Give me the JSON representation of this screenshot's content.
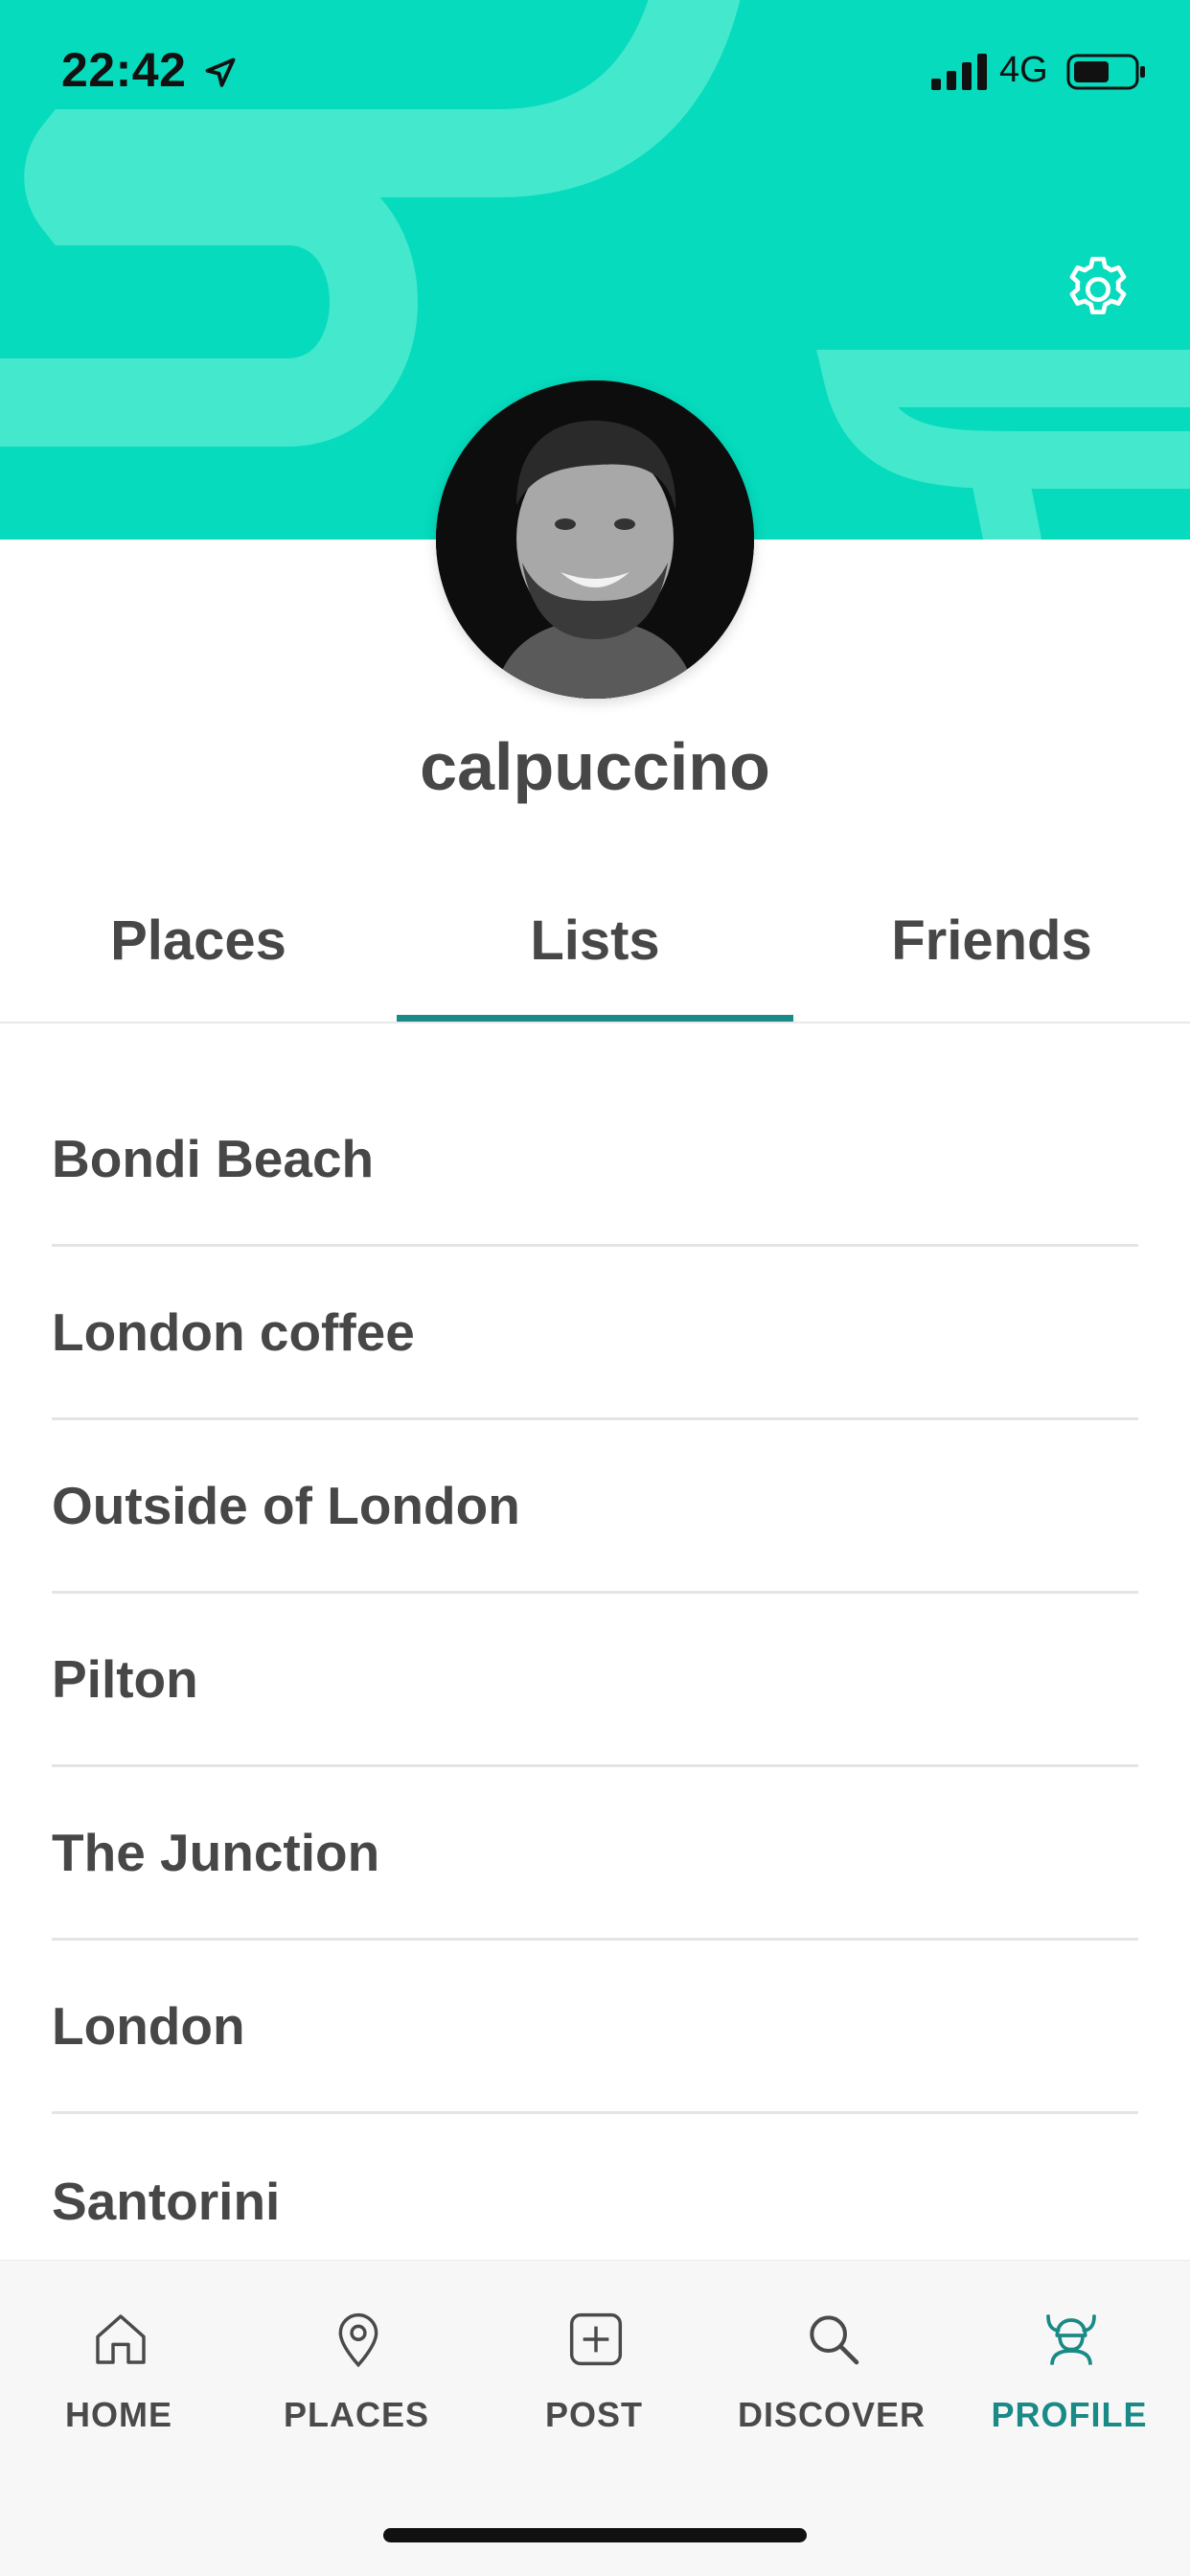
{
  "status_bar": {
    "time": "22:42",
    "network": "4G",
    "location_icon": "location-arrow-icon",
    "signal_icon": "signal-bars-icon",
    "battery_icon": "battery-icon"
  },
  "header": {
    "color": "#06dbbd",
    "settings_icon": "gear-icon"
  },
  "profile": {
    "username": "calpuccino",
    "avatar": "profile-photo"
  },
  "tabs": [
    {
      "label": "Places",
      "active": false
    },
    {
      "label": "Lists",
      "active": true
    },
    {
      "label": "Friends",
      "active": false
    }
  ],
  "lists": [
    "Bondi Beach",
    "London coffee",
    "Outside of London",
    "Pilton",
    "The Junction",
    "London",
    "Santorini"
  ],
  "nav": [
    {
      "label": "HOME",
      "icon": "home-icon",
      "active": false
    },
    {
      "label": "PLACES",
      "icon": "map-pin-icon",
      "active": false
    },
    {
      "label": "POST",
      "icon": "plus-square-icon",
      "active": false
    },
    {
      "label": "DISCOVER",
      "icon": "search-icon",
      "active": false
    },
    {
      "label": "PROFILE",
      "icon": "viking-icon",
      "active": true
    }
  ],
  "colors": {
    "accent": "#1a8a87",
    "text": "#474747"
  }
}
